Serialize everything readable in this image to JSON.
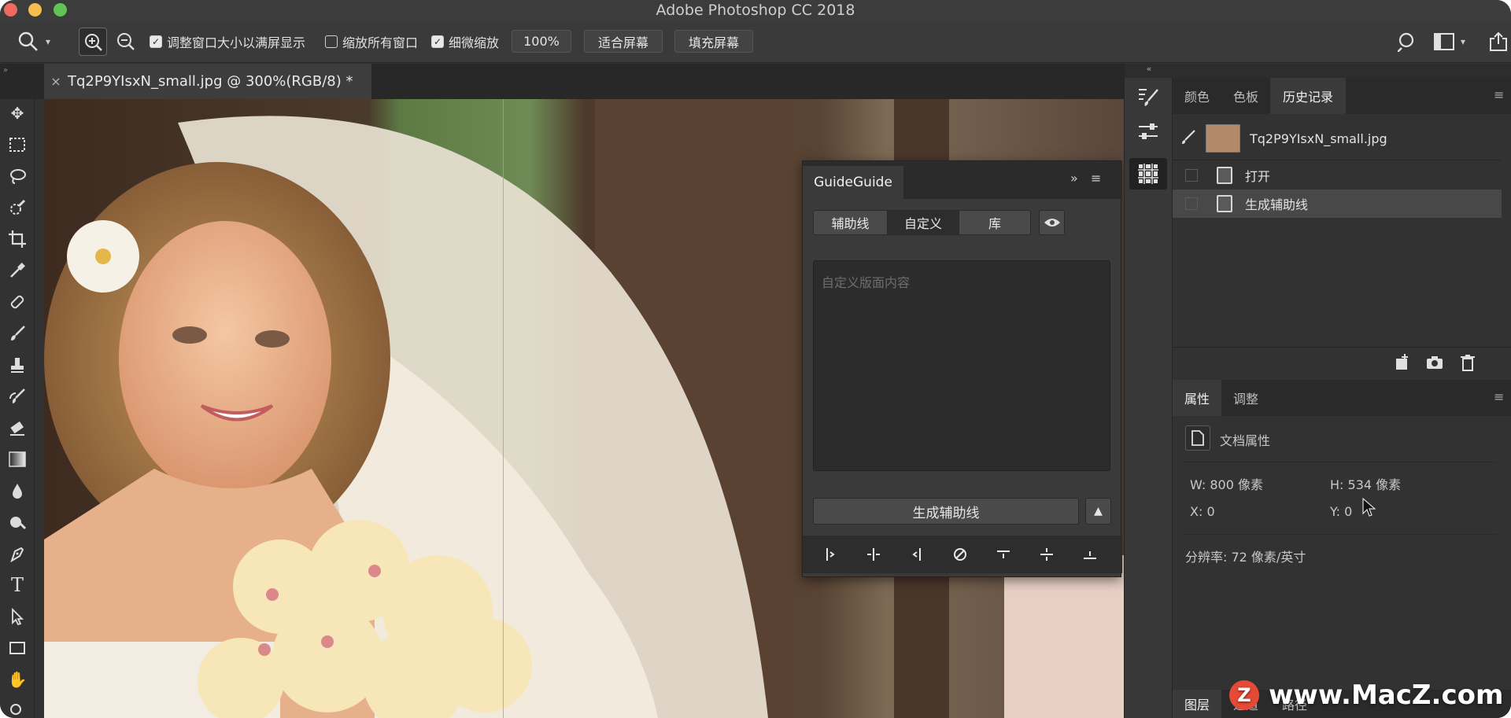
{
  "window": {
    "title": "Adobe Photoshop CC 2018"
  },
  "options_bar": {
    "resize_windows_label": "调整窗口大小以满屏显示",
    "zoom_all_windows_label": "缩放所有窗口",
    "scrubby_zoom_label": "细微缩放",
    "zoom_value": "100%",
    "fit_screen_label": "适合屏幕",
    "fill_screen_label": "填充屏幕",
    "checkbox_states": {
      "resize_windows": true,
      "zoom_all_windows": false,
      "scrubby_zoom": true
    }
  },
  "document": {
    "tab_label": "Tq2P9YIsxN_small.jpg @ 300%(RGB/8) *",
    "close_glyph": "×"
  },
  "guideguide": {
    "title": "GuideGuide",
    "tabs": [
      "辅助线",
      "自定义",
      "库"
    ],
    "active_tab": "自定义",
    "custom_placeholder": "自定义版面内容",
    "generate_label": "生成辅助线"
  },
  "history_panel": {
    "tabs": [
      "颜色",
      "色板",
      "历史记录"
    ],
    "active_tab": "历史记录",
    "snapshot_name": "Tq2P9YIsxN_small.jpg",
    "items": [
      "打开",
      "生成辅助线"
    ]
  },
  "properties_panel": {
    "tabs": [
      "属性",
      "调整"
    ],
    "active_tab": "属性",
    "doc_props_label": "文档属性",
    "w": "W: 800 像素",
    "h": "H: 534 像素",
    "x": "X: 0",
    "y": "Y: 0",
    "resolution": "分辨率: 72 像素/英寸"
  },
  "layers_panel": {
    "tabs": [
      "图层",
      "通道",
      "路径"
    ]
  },
  "watermark": {
    "logo_letter": "Z",
    "text": "www.MacZ.com"
  },
  "colors": {
    "guide": "#34d3c2",
    "close": "#ed6a5e",
    "minimize": "#f5bf4f",
    "maximize": "#61c554"
  }
}
